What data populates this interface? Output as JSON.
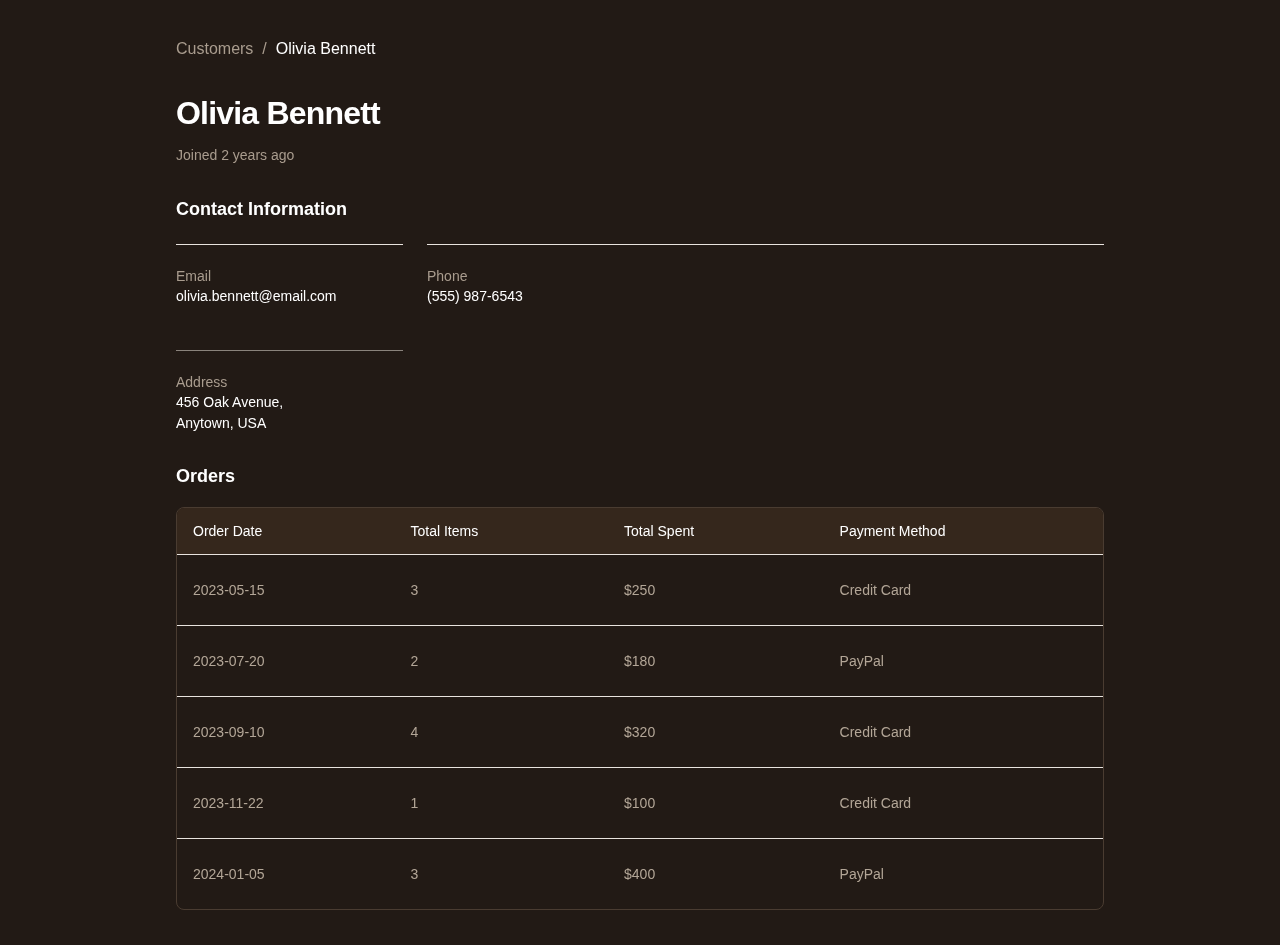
{
  "breadcrumb": {
    "separator": "/",
    "items": [
      {
        "label": "Customers",
        "current": false
      },
      {
        "label": "Olivia Bennett",
        "current": true
      }
    ]
  },
  "customer": {
    "name": "Olivia Bennett",
    "joined": "Joined 2 years ago"
  },
  "contact": {
    "title": "Contact Information",
    "fields": [
      {
        "label": "Email",
        "lines": [
          "olivia.bennett@email.com"
        ]
      },
      {
        "label": "Phone",
        "lines": [
          "(555) 987-6543"
        ]
      },
      {
        "label": "Address",
        "lines": [
          "456 Oak Avenue,",
          "Anytown, USA"
        ]
      }
    ]
  },
  "orders": {
    "title": "Orders",
    "table": {
      "columns": [
        "Order Date",
        "Total Items",
        "Total Spent",
        "Payment Method"
      ],
      "rows": [
        [
          "2023-05-15",
          "3",
          "$250",
          "Credit Card"
        ],
        [
          "2023-07-20",
          "2",
          "$180",
          "PayPal"
        ],
        [
          "2023-09-10",
          "4",
          "$320",
          "Credit Card"
        ],
        [
          "2023-11-22",
          "1",
          "$100",
          "Credit Card"
        ],
        [
          "2024-01-05",
          "3",
          "$400",
          "PayPal"
        ]
      ]
    }
  }
}
